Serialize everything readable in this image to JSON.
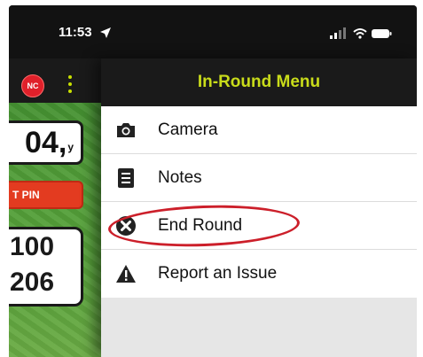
{
  "status_bar": {
    "time": "11:53"
  },
  "map": {
    "player_badge": "NC",
    "distance_value": "04,",
    "distance_unit": "y",
    "set_pin_label": "T PIN",
    "yardage_top": "100",
    "yardage_bottom": "206"
  },
  "menu": {
    "title": "In-Round Menu",
    "items": [
      {
        "label": "Camera",
        "icon": "camera-icon"
      },
      {
        "label": "Notes",
        "icon": "notes-icon"
      },
      {
        "label": "End Round",
        "icon": "close-circle-icon"
      },
      {
        "label": "Report an Issue",
        "icon": "warning-icon"
      }
    ]
  },
  "colors": {
    "accent": "#c9dc1a",
    "annotation": "#cc1f2a",
    "header_bg": "#1a1a1a",
    "set_pin": "#e33b20"
  }
}
